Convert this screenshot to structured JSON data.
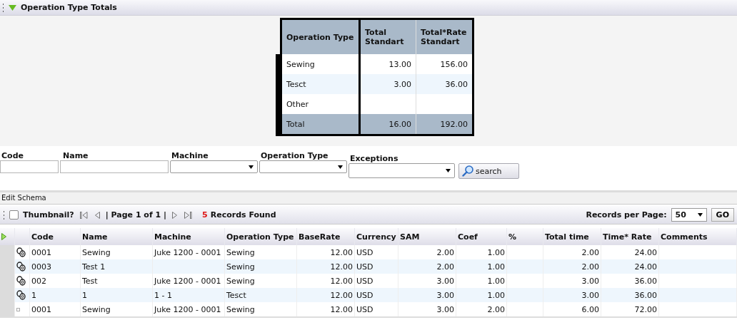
{
  "totals_panel": {
    "title": "Operation Type Totals",
    "expanded": true,
    "table": {
      "columns": [
        "Operation Type",
        "Total Standart",
        "Total*Rate Standart"
      ],
      "rows": [
        {
          "kind": "item",
          "cells": [
            "Sewing",
            "13.00",
            "156.00"
          ]
        },
        {
          "kind": "item",
          "cells": [
            "Tesct",
            "3.00",
            "36.00"
          ]
        },
        {
          "kind": "item",
          "cells": [
            "Other",
            "",
            ""
          ]
        },
        {
          "kind": "total",
          "cells": [
            "Total",
            "16.00",
            "192.00"
          ]
        }
      ]
    }
  },
  "filters": [
    {
      "label": "Code",
      "kind": "text"
    },
    {
      "label": "Name",
      "kind": "text"
    },
    {
      "label": "Machine",
      "kind": "select"
    },
    {
      "label": "Operation Type",
      "kind": "select"
    },
    {
      "label": "Exceptions",
      "kind": "select"
    }
  ],
  "search_button": "search",
  "edit_schema": "Edit Schema",
  "toolbar": {
    "thumbnail": {
      "label": "Thumbnail?",
      "checked": false
    },
    "page_info": "| Page 1 of 1 |",
    "records_count": "5",
    "records_label": "Records Found",
    "per_page_label": "Records per Page:",
    "per_page_value": "50",
    "go_button": "GO"
  },
  "grid": {
    "columns": [
      "Code",
      "Name",
      "Machine",
      "Operation Type",
      "BaseRate",
      "Currency",
      "SAM",
      "Coef",
      "%",
      "Total time",
      "Time* Rate",
      "Comments"
    ],
    "rows": [
      {
        "kind": "linked",
        "cells": [
          "0001",
          "Sewing",
          "Juke 1200 - 0001",
          "Sewing",
          "12.00",
          "USD",
          "2.00",
          "1.00",
          "",
          "2.00",
          "24.00",
          ""
        ]
      },
      {
        "kind": "linked",
        "cells": [
          "0003",
          "Test 1",
          "",
          "Sewing",
          "12.00",
          "USD",
          "2.00",
          "1.00",
          "",
          "2.00",
          "24.00",
          ""
        ]
      },
      {
        "kind": "linked",
        "cells": [
          "002",
          "Test",
          "Juke 1200 - 0001",
          "Sewing",
          "12.00",
          "USD",
          "3.00",
          "1.00",
          "",
          "3.00",
          "36.00",
          ""
        ]
      },
      {
        "kind": "linked",
        "cells": [
          "1",
          "1",
          "1 - 1",
          "Tesct",
          "12.00",
          "USD",
          "3.00",
          "1.00",
          "",
          "3.00",
          "36.00",
          ""
        ]
      },
      {
        "kind": "plain",
        "cells": [
          "0001",
          "Sewing",
          "Juke 1200 - 0001",
          "Sewing",
          "12.00",
          "USD",
          "3.00",
          "2.00",
          "",
          "6.00",
          "72.00",
          ""
        ]
      }
    ]
  }
}
